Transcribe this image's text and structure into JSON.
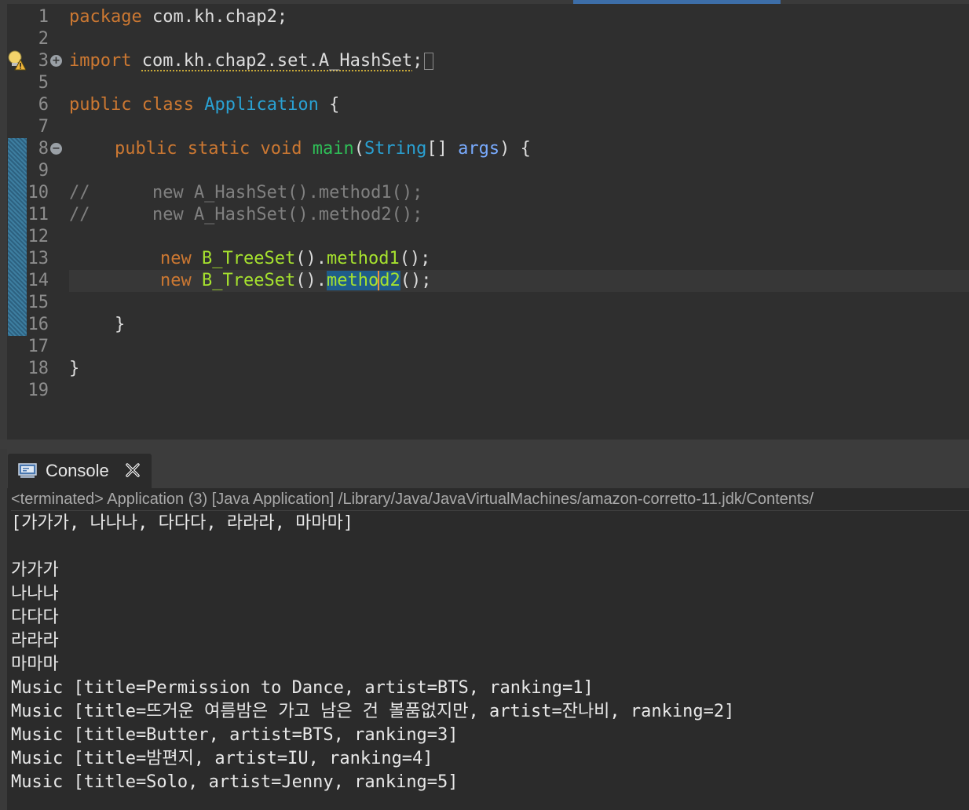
{
  "editor": {
    "lines": [
      {
        "num": "1"
      },
      {
        "num": "2"
      },
      {
        "num": "3"
      },
      {
        "num": "5"
      },
      {
        "num": "6"
      },
      {
        "num": "7"
      },
      {
        "num": "8"
      },
      {
        "num": "9"
      },
      {
        "num": "10"
      },
      {
        "num": "11"
      },
      {
        "num": "12"
      },
      {
        "num": "13"
      },
      {
        "num": "14"
      },
      {
        "num": "15"
      },
      {
        "num": "16"
      },
      {
        "num": "17"
      },
      {
        "num": "18"
      },
      {
        "num": "19"
      }
    ],
    "tokens": {
      "package_kw": "package",
      "package_name": " com.kh.chap2;",
      "import_kw": "import",
      "import_path": "com.kh.chap2.set.A_HashSet",
      "import_semi": ";",
      "public_kw": "public",
      "class_kw": "class",
      "class_name": "Application",
      "brace_open": " {",
      "static_kw": "static",
      "void_kw": "void",
      "main_name": "main",
      "string_type": "String",
      "array_brackets": "[] ",
      "args_name": "args",
      "main_sig_end": ") {",
      "comment_line10": "//      new A_HashSet().method1();",
      "comment_line11": "//      new A_HashSet().method2();",
      "new_kw": "new",
      "treeset_name": "B_TreeSet",
      "call_dot": "().",
      "method1_name": "method1",
      "method2_part1": "metho",
      "method2_part2": "d2",
      "call_end": "();",
      "brace_close": "}"
    },
    "colors": {
      "keyword": "#cc7832",
      "class_name": "#2aa1d3",
      "method_call": "#a6e22e",
      "comment": "#808080",
      "selection": "#1f5d8a"
    }
  },
  "console": {
    "tab_label": "Console",
    "status": "<terminated> Application (3) [Java Application] /Library/Java/JavaVirtualMachines/amazon-corretto-11.jdk/Contents/",
    "output": [
      "[가가가, 나나나, 다다다, 라라라, 마마마]",
      "",
      "가가가",
      "나나나",
      "다다다",
      "라라라",
      "마마마",
      "Music [title=Permission to Dance, artist=BTS, ranking=1]",
      "Music [title=뜨거운 여름밤은 가고 남은 건 볼품없지만, artist=잔나비, ranking=2]",
      "Music [title=Butter, artist=BTS, ranking=3]",
      "Music [title=밤편지, artist=IU, ranking=4]",
      "Music [title=Solo, artist=Jenny, ranking=5]"
    ]
  }
}
